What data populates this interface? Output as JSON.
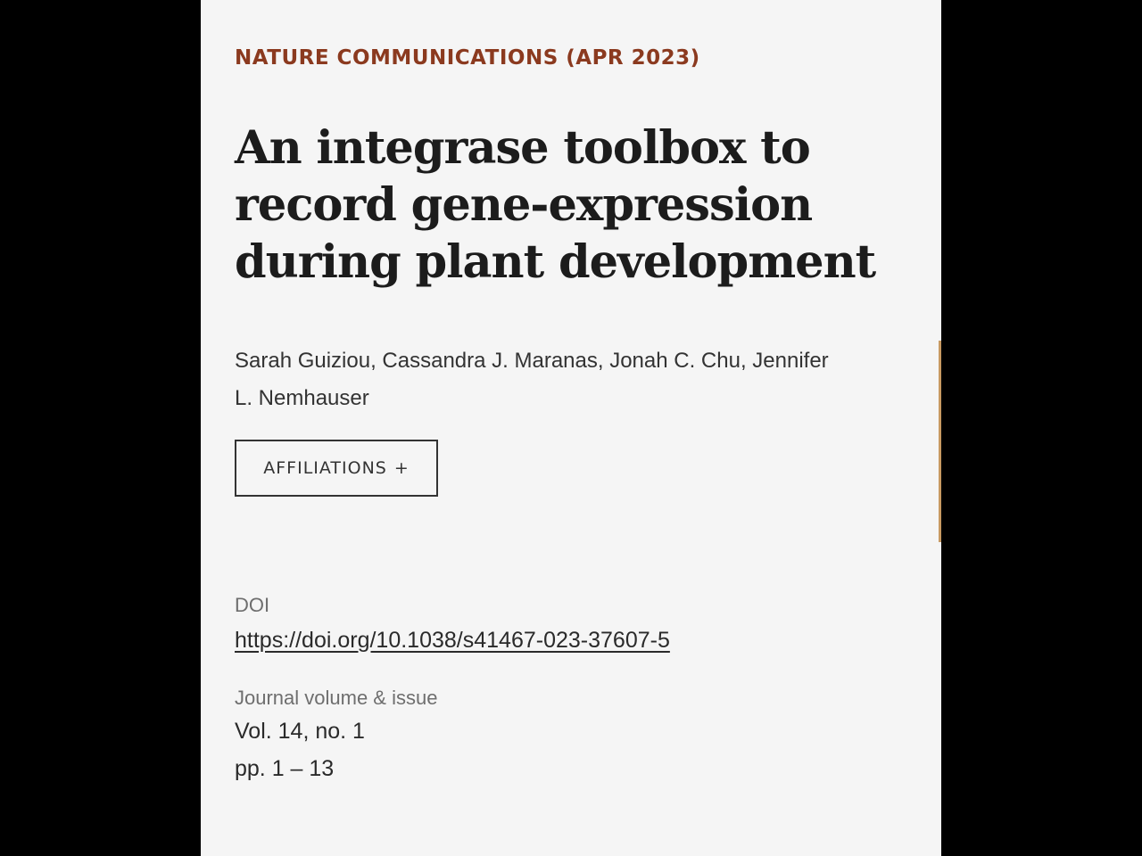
{
  "journal_line": "NATURE COMMUNICATIONS (APR 2023)",
  "title": "An integrase toolbox to record gene-expression during plant development",
  "authors": "Sarah Guiziou, Cassandra J. Maranas, Jonah C. Chu, Jennifer L. Nemhauser",
  "affiliations_button": {
    "label": "AFFILIATIONS",
    "icon": "plus-icon",
    "symbol": "+"
  },
  "doi": {
    "label": "DOI",
    "url": "https://doi.org/10.1038/s41467-023-37607-5"
  },
  "journal_info": {
    "label": "Journal volume & issue",
    "volume": "Vol. 14, no. 1",
    "pages": "pp. 1 – 13"
  },
  "colors": {
    "journal_accent": "#8b3a1f",
    "side_accent": "#c89a62",
    "page_background": "#f5f5f5",
    "outer_background": "#000000"
  }
}
